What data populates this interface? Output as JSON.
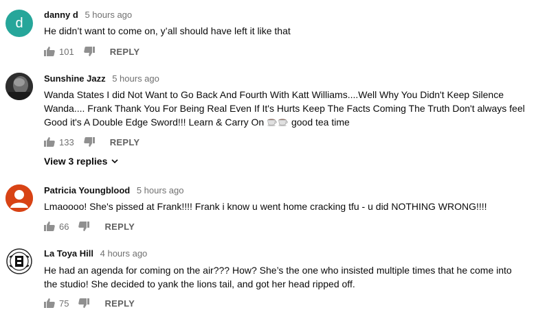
{
  "comments": [
    {
      "author": "danny d",
      "time": "5 hours ago",
      "avatar_letter": "d",
      "avatar_color": "#26a69a",
      "text": "He didn’t want to come on, y’all should have left it like that",
      "likes": "101",
      "reply_label": "REPLY"
    },
    {
      "author": "Sunshine Jazz",
      "time": "5 hours ago",
      "avatar_color": "#444444",
      "text": "Wanda States I did Not Want to Go Back And Fourth With Katt Williams....Well Why You Didn't Keep Silence Wanda.... Frank Thank You For Being Real Even If It's Hurts Keep The Facts Coming The Truth Don't always feel Good it's A Double Edge Sword!!! Learn & Carry On",
      "text_suffix": "good tea time",
      "likes": "133",
      "reply_label": "REPLY",
      "view_replies": "View 3 replies"
    },
    {
      "author": "Patricia Youngblood",
      "time": "5 hours ago",
      "avatar_color": "#d84315",
      "text": "Lmaoooo! She's pissed at Frank!!!! Frank  i know u went home cracking tfu - u did NOTHING WRONG!!!!",
      "likes": "66",
      "reply_label": "REPLY"
    },
    {
      "author": "La Toya Hill",
      "time": "4 hours ago",
      "avatar_color": "#ffffff",
      "text": "He had an agenda for coming on the air???  How?  She’s the one who insisted multiple times that he come into the studio!  She decided to yank the lions tail, and got her head ripped off.",
      "likes": "75",
      "reply_label": "REPLY"
    }
  ],
  "icons": {
    "like": "thumbs-up-icon",
    "dislike": "thumbs-down-icon",
    "expand": "chevron-down-icon",
    "emoji": "coffee-cup-icon"
  }
}
